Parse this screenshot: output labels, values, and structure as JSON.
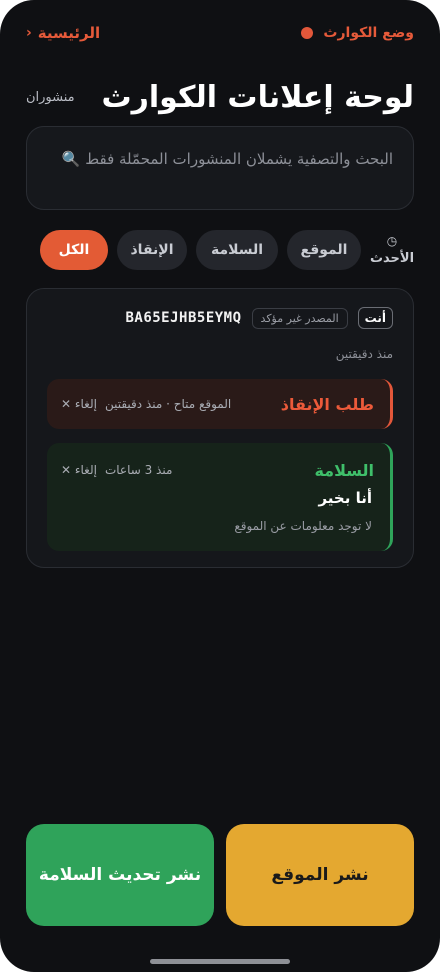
{
  "topbar": {
    "mode_label": "وضع الكوارث",
    "home_label": "الرئيسية",
    "home_chevron": "‹"
  },
  "header": {
    "title": "لوحة إعلانات الكوارث",
    "posts_count": "منشوران"
  },
  "search": {
    "icon": "search-icon",
    "text": "البحث والتصفية يشملان المنشورات المحمّلة فقط"
  },
  "filters": {
    "latest_label": "الأحدث",
    "latest_icon": "clock-icon",
    "chips": [
      "الموقع",
      "السلامة",
      "الإنقاذ",
      "الكل"
    ],
    "active": "الكل"
  },
  "card": {
    "you_badge": "أنت",
    "unverified": "المصدر غير مؤكد",
    "device_id": "BA65EJHB5EYMQ",
    "time": "منذ دقيقتين",
    "messages": [
      {
        "title": "طلب الإنقاذ",
        "meta": "الموقع متاح · منذ دقيقتين",
        "cancel": "إلغاء ✕"
      },
      {
        "title": "السلامة",
        "meta": "منذ 3 ساعات",
        "cancel": "إلغاء ✕",
        "body": "أنا بخير",
        "sub": "لا توجد معلومات عن الموقع"
      }
    ]
  },
  "actions": {
    "post_location": "نشر الموقع",
    "post_safety": "نشر تحديث السلامة"
  },
  "colors": {
    "accent": "#e35b35",
    "safety": "#2fa35a",
    "location": "#e4a830"
  }
}
